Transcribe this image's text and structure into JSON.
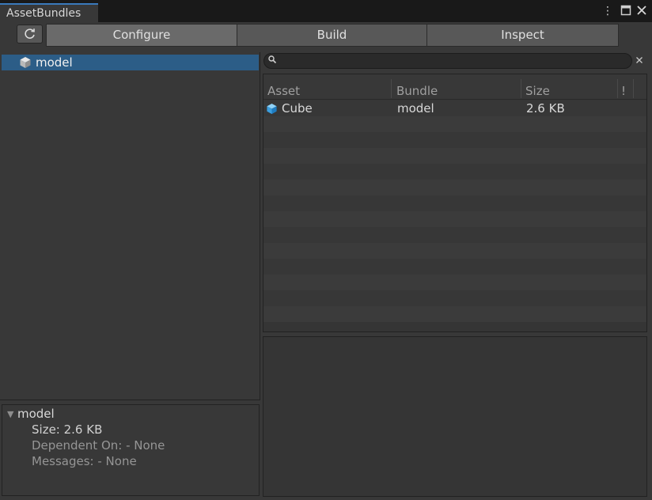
{
  "window": {
    "tab_title": "AssetBundles",
    "menu_icon": "kebab-menu-icon",
    "maximize_icon": "maximize-icon",
    "close_icon": "close-icon"
  },
  "toolbar": {
    "refresh_icon": "refresh-icon",
    "tabs": [
      {
        "label": "Configure",
        "active": true
      },
      {
        "label": "Build",
        "active": false
      },
      {
        "label": "Inspect",
        "active": false
      }
    ]
  },
  "bundle_tree": {
    "items": [
      {
        "label": "model",
        "icon": "bundle-cube-icon",
        "selected": true
      }
    ]
  },
  "details": {
    "title": "model",
    "size": "Size: 2.6 KB",
    "dependent_on": "Dependent On: - None",
    "messages": "Messages: - None"
  },
  "search": {
    "value": "",
    "placeholder": ""
  },
  "asset_table": {
    "columns": [
      "Asset",
      "Bundle",
      "Size",
      "!"
    ],
    "rows": [
      {
        "asset": "Cube",
        "bundle": "model",
        "size": "2.6 KB",
        "icon": "cube-icon"
      }
    ]
  },
  "colors": {
    "accent": "#3a79bb",
    "selection": "#2c5d87",
    "panel_bg": "#383838",
    "title_bar": "#191919"
  }
}
